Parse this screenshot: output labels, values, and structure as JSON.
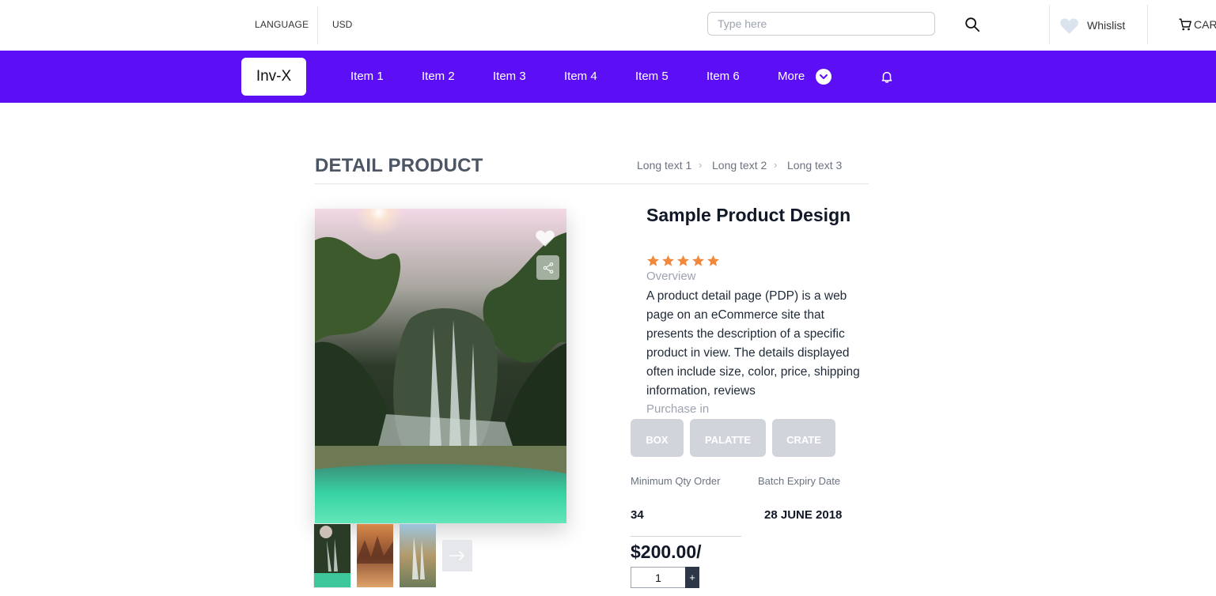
{
  "topbar": {
    "language": "LANGUAGE",
    "currency": "USD",
    "search_placeholder": "Type here",
    "wishlist": "Whislist",
    "cart": "CART"
  },
  "nav": {
    "logo": "Inv-X",
    "items": [
      "Item 1",
      "Item 2",
      "Item 3",
      "Item 4",
      "Item 5",
      "Item 6"
    ],
    "more": "More"
  },
  "page": {
    "title": "DETAIL PRODUCT",
    "breadcrumb": [
      "Long text 1",
      "Long text 2",
      "Long text 3"
    ]
  },
  "product": {
    "name": "Sample Product Design",
    "rating": 5,
    "overview_label": "Overview",
    "description": "A product detail page (PDP) is a web page on an eCommerce site that presents the description of a specific product in view. The details displayed often include size, color, price, shipping information, reviews",
    "purchase_label": "Purchase in",
    "packages": [
      "BOX",
      "PALATTE",
      "CRATE"
    ],
    "min_qty_label": "Minimum Qty Order",
    "min_qty_value": "34",
    "expiry_label": "Batch Expiry Date",
    "expiry_value": "28 JUNE 2018",
    "price": "$200.00/",
    "quantity": "1",
    "plus_label": "+"
  },
  "colors": {
    "brand": "#5c0ff5",
    "star": "#f2883a",
    "package_button": "#d1d5db"
  },
  "icons": [
    "search-icon",
    "heart-icon",
    "cart-icon",
    "chevron-down-icon",
    "bell-icon",
    "share-icon",
    "arrow-right-icon"
  ]
}
